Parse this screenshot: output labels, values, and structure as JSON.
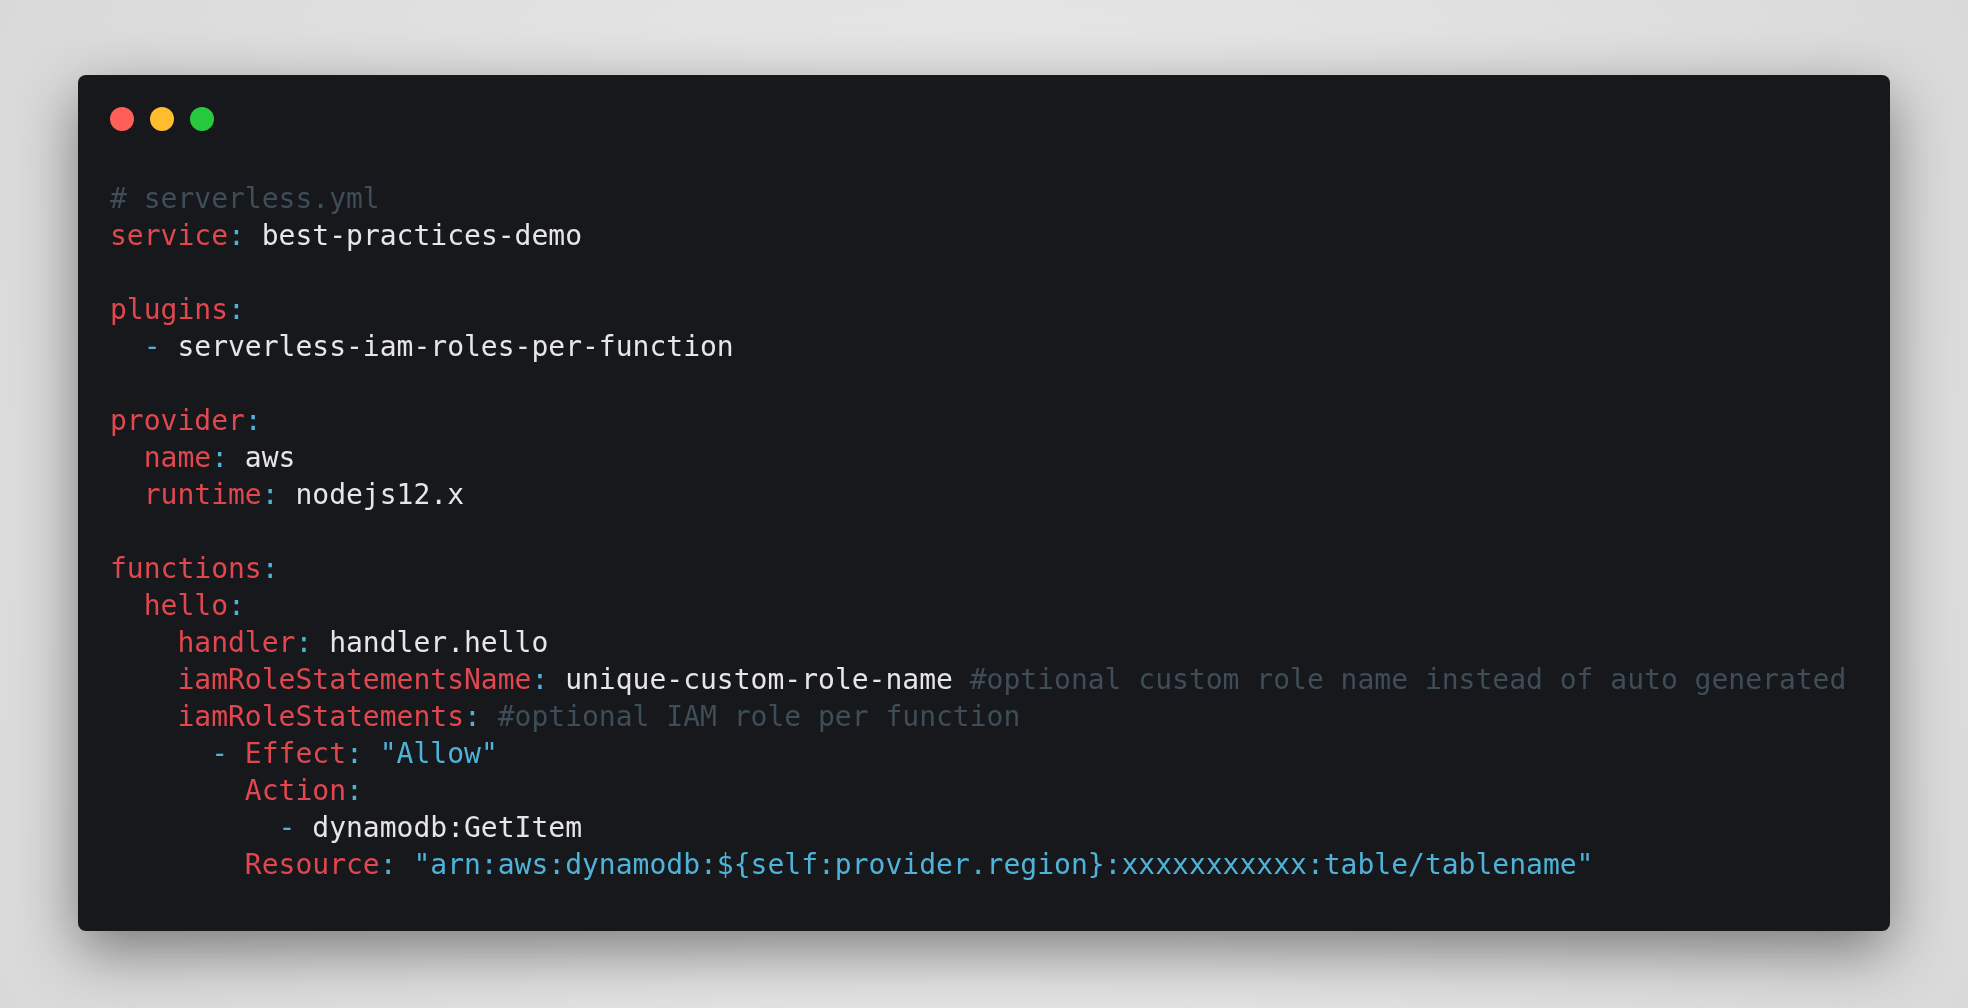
{
  "window": {
    "controls": [
      {
        "kind": "close"
      },
      {
        "kind": "minimize"
      },
      {
        "kind": "zoom"
      }
    ]
  },
  "blocks": [
    [
      {
        "tokens": [
          {
            "kind": "comment",
            "text": "# serverless.yml"
          }
        ]
      },
      {
        "tokens": [
          {
            "kind": "key",
            "text": "service"
          },
          {
            "kind": "colon",
            "text": ":"
          },
          {
            "kind": "value",
            "text": "best-practices-demo"
          }
        ]
      }
    ],
    [
      {
        "tokens": [
          {
            "kind": "key",
            "text": "plugins"
          },
          {
            "kind": "colon",
            "text": ":"
          }
        ],
        "children": [
          {
            "tokens": [
              {
                "kind": "dash",
                "text": "-"
              },
              {
                "kind": "value",
                "text": "serverless-iam-roles-per-function"
              }
            ]
          }
        ]
      }
    ],
    [
      {
        "tokens": [
          {
            "kind": "key",
            "text": "provider"
          },
          {
            "kind": "colon",
            "text": ":"
          }
        ],
        "children": [
          {
            "tokens": [
              {
                "kind": "key",
                "text": "name"
              },
              {
                "kind": "colon",
                "text": ":"
              },
              {
                "kind": "value",
                "text": "aws"
              }
            ]
          },
          {
            "tokens": [
              {
                "kind": "key",
                "text": "runtime"
              },
              {
                "kind": "colon",
                "text": ":"
              },
              {
                "kind": "value",
                "text": "nodejs12.x"
              }
            ]
          }
        ]
      }
    ],
    [
      {
        "tokens": [
          {
            "kind": "key",
            "text": "functions"
          },
          {
            "kind": "colon",
            "text": ":"
          }
        ],
        "children": [
          {
            "tokens": [
              {
                "kind": "key",
                "text": "hello"
              },
              {
                "kind": "colon",
                "text": ":"
              }
            ],
            "children": [
              {
                "tokens": [
                  {
                    "kind": "key",
                    "text": "handler"
                  },
                  {
                    "kind": "colon",
                    "text": ":"
                  },
                  {
                    "kind": "value",
                    "text": "handler.hello"
                  }
                ]
              },
              {
                "tokens": [
                  {
                    "kind": "key",
                    "text": "iamRoleStatementsName"
                  },
                  {
                    "kind": "colon",
                    "text": ":"
                  },
                  {
                    "kind": "value",
                    "text": "unique-custom-role-name"
                  },
                  {
                    "kind": "comment",
                    "text": "#optional custom role name instead of auto generated"
                  }
                ]
              },
              {
                "tokens": [
                  {
                    "kind": "key",
                    "text": "iamRoleStatements"
                  },
                  {
                    "kind": "colon",
                    "text": ":"
                  },
                  {
                    "kind": "comment",
                    "text": "#optional IAM role per function"
                  }
                ],
                "children": [
                  {
                    "tokens": [
                      {
                        "kind": "dash",
                        "text": "-"
                      },
                      {
                        "kind": "key",
                        "text": "Effect"
                      },
                      {
                        "kind": "colon",
                        "text": ":"
                      },
                      {
                        "kind": "string",
                        "text": "\"Allow\""
                      }
                    ],
                    "children": [
                      {
                        "tokens": [
                          {
                            "kind": "key",
                            "text": "Action"
                          },
                          {
                            "kind": "colon",
                            "text": ":"
                          }
                        ],
                        "children": [
                          {
                            "tokens": [
                              {
                                "kind": "dash",
                                "text": "-"
                              },
                              {
                                "kind": "value",
                                "text": "dynamodb:GetItem"
                              }
                            ]
                          }
                        ]
                      },
                      {
                        "tokens": [
                          {
                            "kind": "key",
                            "text": "Resource"
                          },
                          {
                            "kind": "colon",
                            "text": ":"
                          },
                          {
                            "kind": "string",
                            "text": "\"arn:aws:dynamodb:${self:provider.region}:xxxxxxxxxxx:table/tablename\""
                          }
                        ]
                      }
                    ]
                  }
                ]
              }
            ]
          }
        ]
      }
    ]
  ]
}
